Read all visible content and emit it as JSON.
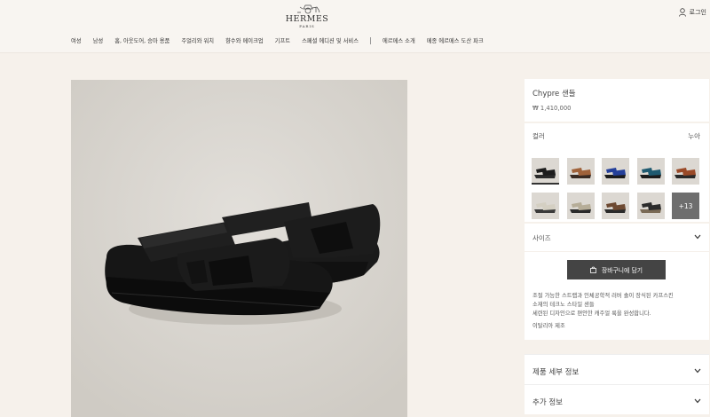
{
  "header": {
    "logo_main": "HERMES",
    "logo_sub": "PARIS",
    "login_label": "로그인",
    "nav": [
      "여성",
      "남성",
      "홈, 아웃도어, 승마 용품",
      "주얼리와 워치",
      "향수와 메이크업",
      "기프트",
      "스페셜 에디션 및 서비스"
    ],
    "nav_secondary": [
      "에르메스 소개",
      "메종 에르메스 도산 파크"
    ]
  },
  "product": {
    "title": "Chypre 샌들",
    "price": "₩ 1,410,000",
    "color_label": "컬러",
    "color_value": "누아",
    "more_colors": "+13",
    "size_label": "사이즈",
    "cart_label": "장바구니에 담기",
    "description_lines": [
      "조절 가능한 스트랩과 인체공학적 러버 솔이 장식된 카프스킨",
      "소재의 테크노 스타일 샌들",
      "세련된 디자인으로 편안한 캐주얼 룩을 완성합니다."
    ],
    "origin": "이탈리아 제조",
    "details_label": "제품 세부 정보",
    "extra_label": "추가 정보"
  },
  "swatch_colors": [
    {
      "strap": "#1d1d1d",
      "sole": "#2a2a2a"
    },
    {
      "strap": "#a0623a",
      "sole": "#3a2a22"
    },
    {
      "strap": "#25409a",
      "sole": "#1c1c1c"
    },
    {
      "strap": "#1f5a70",
      "sole": "#1c1c1c"
    },
    {
      "strap": "#9a4a28",
      "sole": "#2a2a2a"
    },
    {
      "strap": "#d4cfc2",
      "sole": "#3a3a3a"
    },
    {
      "strap": "#b6ad98",
      "sole": "#2a2a2a"
    },
    {
      "strap": "#6e4a32",
      "sole": "#2a2a2a"
    },
    {
      "strap": "#2c2c2c",
      "sole": "#7a6a55"
    }
  ]
}
